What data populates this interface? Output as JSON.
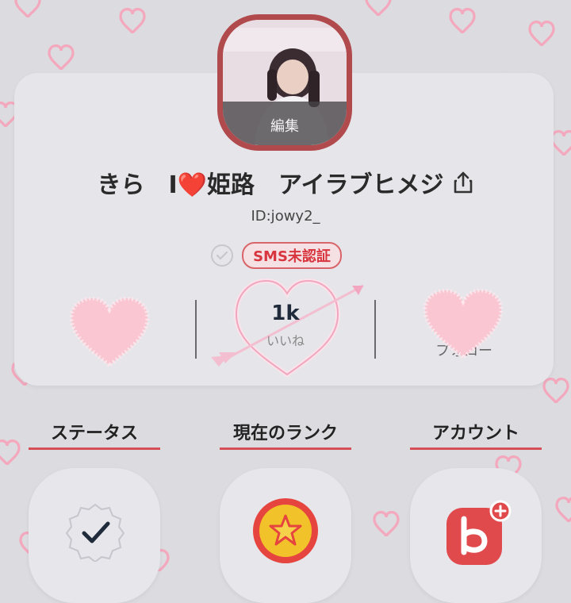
{
  "profile": {
    "avatar_edit_label": "編集",
    "name": "きら　I❤️姫路　アイラブヒメジ",
    "id_text": "ID:jowy2_",
    "sms_badge": "SMS未認証"
  },
  "stats": {
    "likes_count": "1k",
    "likes_label": "いいね",
    "right_label_partial": "フォロー"
  },
  "tabs": [
    {
      "label": "ステータス"
    },
    {
      "label": "現在のランク"
    },
    {
      "label": "アカウント"
    }
  ],
  "colors": {
    "accent": "#d64f57",
    "background": "#dcdce0",
    "card": "#e6e5ea",
    "avatar_border": "#b14a4c",
    "heart_pink": "#f7b8c6"
  },
  "icons": {
    "share": "share-icon",
    "check_circle": "check-circle-icon",
    "status_check": "check-badge-icon",
    "rank_star": "star-coin-icon",
    "account": "account-app-icon"
  }
}
